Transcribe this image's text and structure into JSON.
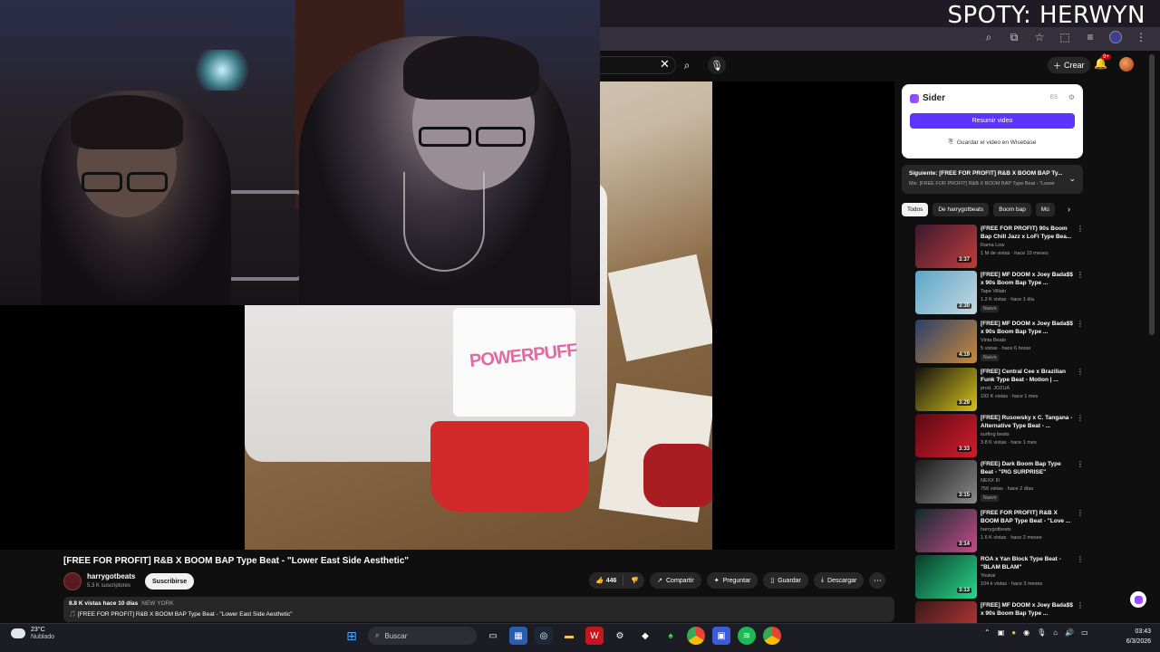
{
  "overlay": {
    "text": "SPOTY: HERWYN"
  },
  "header": {
    "crear_label": "Crear",
    "notif_count": "9+"
  },
  "player": {
    "title": "[FREE FOR PROFIT] R&B X BOOM BAP Type Beat - \"Lower East Side Aesthetic\"",
    "shirt_text": "POWERPUFF"
  },
  "channel": {
    "name": "harrygotbeats",
    "subscribers": "5.3 K suscriptores",
    "subscribe_label": "Suscribirse"
  },
  "actions": {
    "likes": "446",
    "share_label": "Compartir",
    "ask_label": "Preguntar",
    "save_label": "Guardar",
    "download_label": "Descargar"
  },
  "description": {
    "meta": "8.8 K vistas  hace 10 días",
    "location": "NEW YORK",
    "text": "🎵 [FREE FOR PROFIT] R&B X BOOM BAP Type Beat - \"Lower East Side Aesthetic\""
  },
  "sider": {
    "brand": "Sider",
    "lang": "ES",
    "summarize_label": "Resumir video",
    "save_label": "Guardar el video en Wisebase"
  },
  "upnext": {
    "title": "Siguiente: [FREE FOR PROFIT] R&B X BOOM BAP Ty...",
    "subtitle": "Mix: [FREE FOR PROFIT] R&B X BOOM BAP Type Beat - \"Lower"
  },
  "chips": [
    "Todos",
    "De harrygotbeats",
    "Boom bap",
    "Mú"
  ],
  "recommendations": [
    {
      "title": "(FREE FOR PROFIT) 90s Boom Bap Chill Jazz x LoFi Type Bea...",
      "channel": "Rama Low",
      "meta": "1 M de vistas · hace 10 meses",
      "duration": "3:37",
      "badge": "",
      "c1": "#3a1a2e",
      "c2": "#c23c3c"
    },
    {
      "title": "[FREE] MF DOOM x Joey Bada$$ x 90s Boom Bap Type ...",
      "channel": "Tape Villain",
      "meta": "1.2 K vistas · hace 1 día",
      "duration": "3:30",
      "badge": "Nuevo",
      "c1": "#5aa6c9",
      "c2": "#c7d8e0"
    },
    {
      "title": "[FREE] MF DOOM x Joey Bada$$ x 90s Boom Bap Type ...",
      "channel": "Vinta Beats",
      "meta": "5 vistas · hace 6 horas",
      "duration": "4:19",
      "badge": "Nuevo",
      "c1": "#2b3f6a",
      "c2": "#c98a3a"
    },
    {
      "title": "[FREE] Central Cee x Brazilian Funk Type Beat - Motion | ...",
      "channel": "prod. JOZUA",
      "meta": "192 K vistas · hace 1 mes",
      "duration": "3:29",
      "badge": "",
      "c1": "#111111",
      "c2": "#d8c21a"
    },
    {
      "title": "[FREE] Rusowsky x C. Tangana - Alternative Type Beat - ...",
      "channel": "surfing beats",
      "meta": "3.8 K vistas · hace 1 mes",
      "duration": "3:33",
      "badge": "",
      "c1": "#5a0a12",
      "c2": "#d41c2c"
    },
    {
      "title": "(FREE) Dark Boom Bap Type Beat - \"PIG SURPRISE\"",
      "channel": "NEXX III",
      "meta": "756 vistas · hace 2 días",
      "duration": "3:15",
      "badge": "Nuevo",
      "c1": "#1a1a1a",
      "c2": "#8a8a8a"
    },
    {
      "title": "[FREE FOR PROFIT] R&B X BOOM BAP Type Beat - \"Love ...",
      "channel": "harrygotbeats",
      "meta": "1.6 K vistas · hace 2 meses",
      "duration": "3:14",
      "badge": "",
      "c1": "#0f2a2a",
      "c2": "#c84a8a"
    },
    {
      "title": "ROA x Yan Block Type Beat - \"BLAM BLAM\"",
      "channel": "Youkai",
      "meta": "104 k vistas · hace 3 meses",
      "duration": "3:13",
      "badge": "",
      "c1": "#0a3a2a",
      "c2": "#2ad88a"
    },
    {
      "title": "[FREE] MF DOOM x Joey Bada$$ x 90s Boom Bap Type ...",
      "channel": "",
      "meta": "",
      "duration": "",
      "badge": "",
      "c1": "#3a1a1a",
      "c2": "#c83a3a"
    }
  ],
  "taskbar": {
    "temp": "23°C",
    "weather": "Nublado",
    "search_placeholder": "Buscar",
    "time": "03:43",
    "date": "6/3/2026"
  }
}
